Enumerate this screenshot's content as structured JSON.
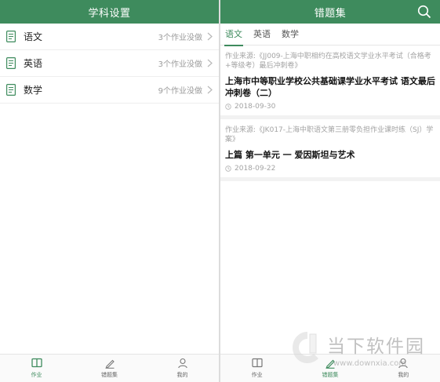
{
  "left": {
    "title": "学科设置",
    "subjects": [
      {
        "name": "语文",
        "status": "3个作业没做"
      },
      {
        "name": "英语",
        "status": "3个作业没做"
      },
      {
        "name": "数学",
        "status": "9个作业没做"
      }
    ],
    "nav": [
      {
        "label": "作业",
        "icon": "book-icon",
        "active": true
      },
      {
        "label": "错题集",
        "icon": "pen-icon",
        "active": false
      },
      {
        "label": "我的",
        "icon": "user-icon",
        "active": false
      }
    ]
  },
  "right": {
    "title": "错题集",
    "tabs": [
      {
        "label": "语文",
        "active": true
      },
      {
        "label": "英语",
        "active": false
      },
      {
        "label": "数学",
        "active": false
      }
    ],
    "cards": [
      {
        "source": "作业来源:《JJ009-上海中职相约在高校语文学业水平考试（合格考+等级考）最后冲刺卷》",
        "title": "上海市中等职业学校公共基础课学业水平考试 语文最后冲刺卷（二）",
        "date": "2018-09-30"
      },
      {
        "source": "作业来源:《JK017-上海中职语文第三册零负担作业课时练（SJ）学案》",
        "title": "上篇 第一单元 一 爱因斯坦与艺术",
        "date": "2018-09-22"
      }
    ],
    "nav": [
      {
        "label": "作业",
        "icon": "book-icon",
        "active": false
      },
      {
        "label": "错题集",
        "icon": "pen-icon",
        "active": true
      },
      {
        "label": "我的",
        "icon": "user-icon",
        "active": false
      }
    ]
  },
  "watermark": {
    "brand": "当下软件园",
    "url": "www.downxia.com"
  },
  "colors": {
    "accent": "#3e8b5d",
    "muted": "#9b9b9b"
  }
}
